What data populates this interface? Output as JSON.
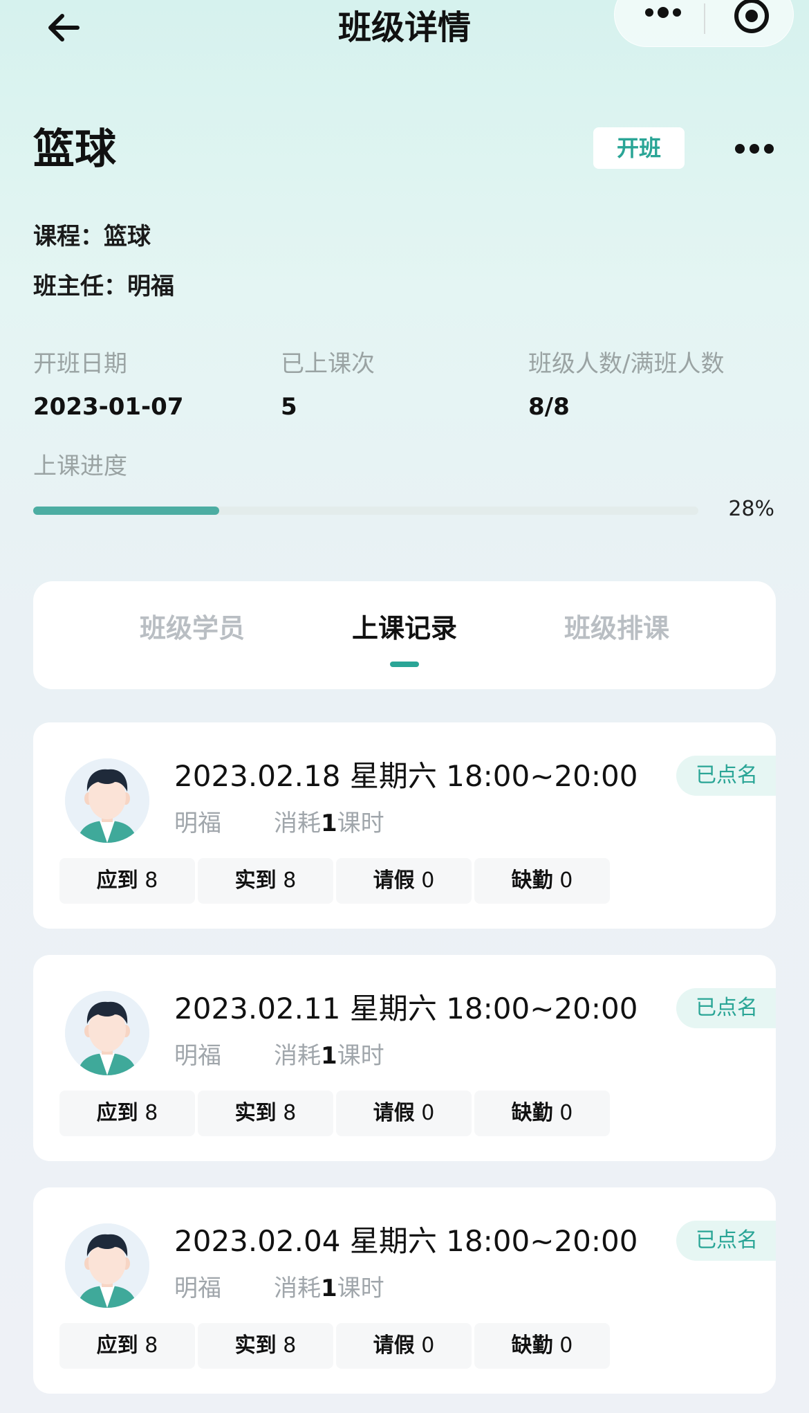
{
  "navbar": {
    "title": "班级详情",
    "back_icon": "arrow-left-icon",
    "menu_icon": "more-dots-icon",
    "close_icon": "target-circle-icon"
  },
  "class": {
    "name": "篮球",
    "open_button": "开班",
    "more_icon": "more-dots-icon",
    "course_line": "课程：篮球",
    "teacher_line": "班主任：明福"
  },
  "stats": [
    {
      "label": "开班日期",
      "value": "2023-01-07"
    },
    {
      "label": "已上课次",
      "value": "5"
    },
    {
      "label": "班级人数/满班人数",
      "value": "8/8"
    }
  ],
  "progress": {
    "label": "上课进度",
    "percent_text": "28%",
    "value": 0.28
  },
  "tabs": [
    {
      "label": "班级学员",
      "active": false
    },
    {
      "label": "上课记录",
      "active": true
    },
    {
      "label": "班级排课",
      "active": false
    }
  ],
  "records": [
    {
      "datetime": "2023.02.18 星期六 18:00~20:00",
      "teacher": "明福",
      "consume_prefix": "消耗",
      "consume_num": "1",
      "consume_suffix": "课时",
      "status": "已点名",
      "attendance": [
        {
          "label": "应到",
          "value": "8"
        },
        {
          "label": "实到",
          "value": "8"
        },
        {
          "label": "请假",
          "value": "0"
        },
        {
          "label": "缺勤",
          "value": "0"
        }
      ]
    },
    {
      "datetime": "2023.02.11 星期六 18:00~20:00",
      "teacher": "明福",
      "consume_prefix": "消耗",
      "consume_num": "1",
      "consume_suffix": "课时",
      "status": "已点名",
      "attendance": [
        {
          "label": "应到",
          "value": "8"
        },
        {
          "label": "实到",
          "value": "8"
        },
        {
          "label": "请假",
          "value": "0"
        },
        {
          "label": "缺勤",
          "value": "0"
        }
      ]
    },
    {
      "datetime": "2023.02.04 星期六 18:00~20:00",
      "teacher": "明福",
      "consume_prefix": "消耗",
      "consume_num": "1",
      "consume_suffix": "课时",
      "status": "已点名",
      "attendance": [
        {
          "label": "应到",
          "value": "8"
        },
        {
          "label": "实到",
          "value": "8"
        },
        {
          "label": "请假",
          "value": "0"
        },
        {
          "label": "缺勤",
          "value": "0"
        }
      ]
    }
  ],
  "colors": {
    "accent": "#2aa596",
    "progress_fill": "#4cada2",
    "badge_bg": "#e6f6f3"
  }
}
